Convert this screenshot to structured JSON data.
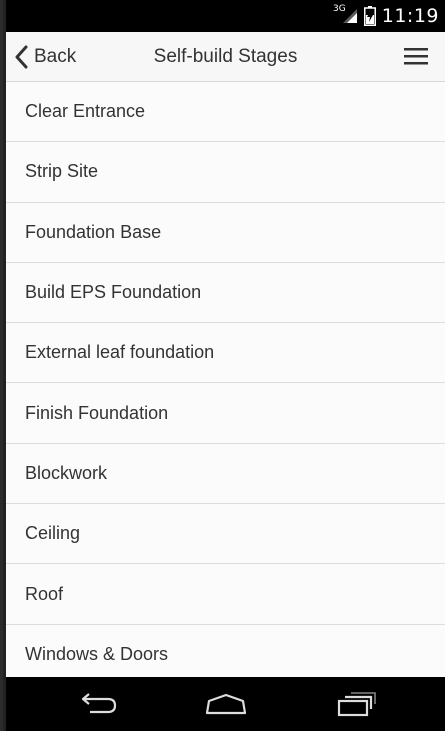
{
  "status_bar": {
    "network_type": "3G",
    "time": "11:19",
    "icons": [
      "signal-icon",
      "battery-icon"
    ]
  },
  "app_bar": {
    "back_label": "Back",
    "title": "Self-build Stages",
    "icons": [
      "chevron-left-icon",
      "hamburger-menu-icon"
    ]
  },
  "stages": [
    {
      "label": "Clear Entrance"
    },
    {
      "label": "Strip Site"
    },
    {
      "label": "Foundation Base"
    },
    {
      "label": "Build EPS Foundation"
    },
    {
      "label": "External leaf foundation"
    },
    {
      "label": "Finish Foundation"
    },
    {
      "label": "Blockwork"
    },
    {
      "label": "Ceiling"
    },
    {
      "label": "Roof"
    },
    {
      "label": "Windows & Doors"
    }
  ],
  "nav_bar": {
    "icons": [
      "back-arrow-icon",
      "home-icon",
      "recent-apps-icon"
    ]
  },
  "colors": {
    "status_bar": "#000000",
    "app_bar": "#f8f7f7",
    "list_background": "#fbfbfb",
    "divider": "#dcdcdc",
    "text": "#333333"
  }
}
